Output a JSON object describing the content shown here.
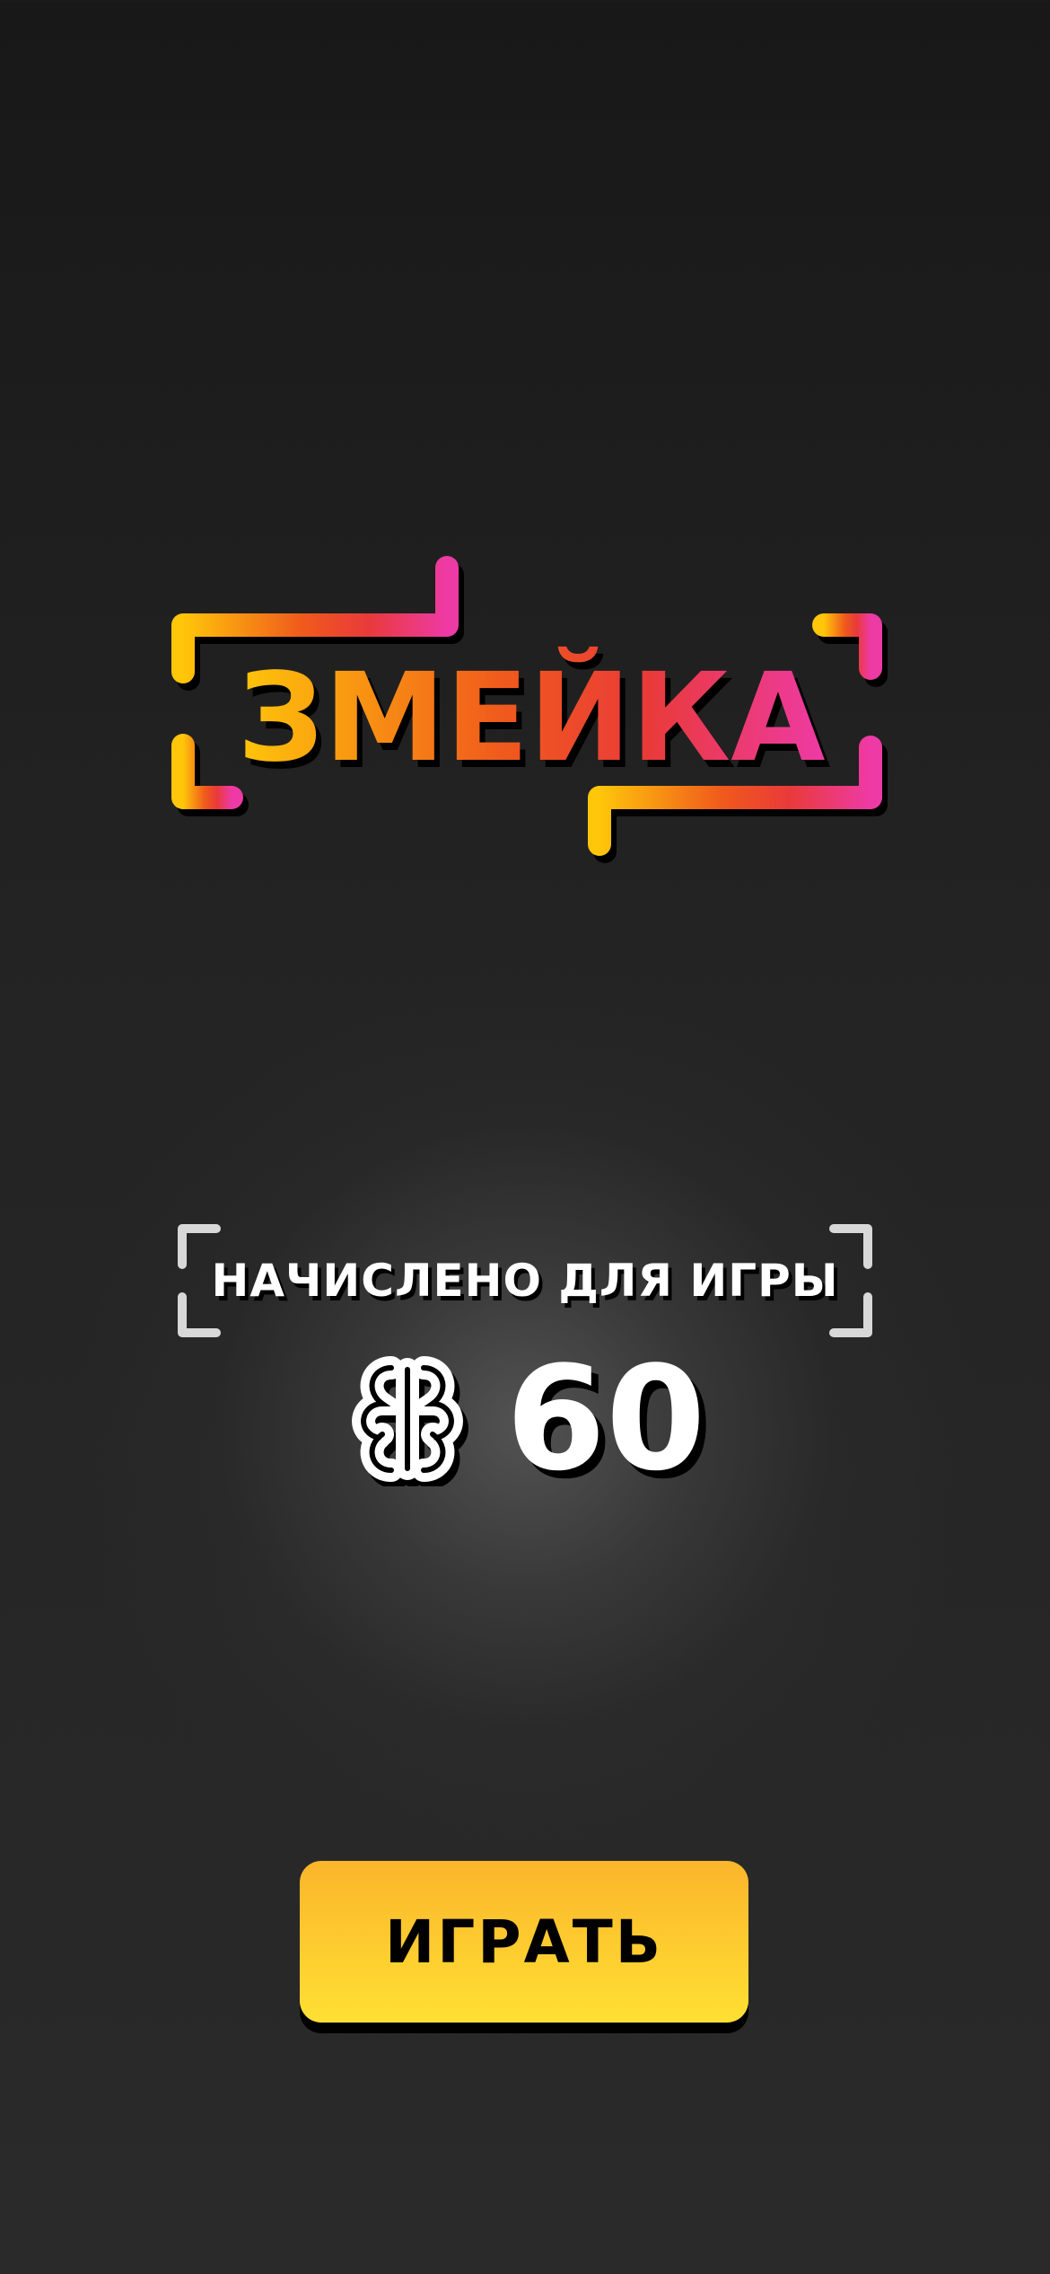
{
  "game": {
    "title": "ЗМЕЙКА",
    "accent_colors": {
      "logo_gradient_start": "#ffc107",
      "logo_gradient_mid": "#ef5a1a",
      "logo_gradient_end": "#ee3aa5",
      "button_top": "#fbb52b",
      "button_bottom": "#ffe033"
    }
  },
  "credit": {
    "label": "НАЧИСЛЕНО ДЛЯ ИГРЫ",
    "currency_icon": "spasibo-coin-icon",
    "amount": "60"
  },
  "actions": {
    "play_label": "ИГРАТЬ"
  }
}
